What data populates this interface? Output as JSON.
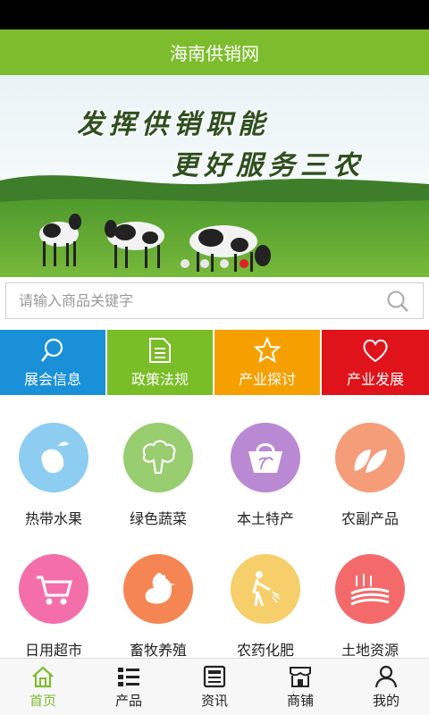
{
  "app": {
    "title": "海南供销网"
  },
  "banner": {
    "slogan_line1": "发挥供销职能",
    "slogan_line2": "更好服务三农",
    "slide_count": 4,
    "active_slide": 3
  },
  "search": {
    "placeholder": "请输入商品关键字"
  },
  "quick_links": [
    {
      "label": "展会信息",
      "icon": "search-icon",
      "color": "#1a90d8"
    },
    {
      "label": "政策法规",
      "icon": "document-icon",
      "color": "#79bd27"
    },
    {
      "label": "产业探讨",
      "icon": "star-icon",
      "color": "#f5a000"
    },
    {
      "label": "产业发展",
      "icon": "heart-icon",
      "color": "#e0131b"
    }
  ],
  "categories": [
    {
      "label": "热带水果",
      "icon": "mango-icon",
      "color": "#8ccdf1"
    },
    {
      "label": "绿色蔬菜",
      "icon": "broccoli-icon",
      "color": "#98cd70"
    },
    {
      "label": "本土特产",
      "icon": "basket-icon",
      "color": "#b98ad3"
    },
    {
      "label": "农副产品",
      "icon": "leaves-icon",
      "color": "#f59d78"
    },
    {
      "label": "日用超市",
      "icon": "cart-icon",
      "color": "#f46fa9"
    },
    {
      "label": "畜牧养殖",
      "icon": "chicken-icon",
      "color": "#f58552"
    },
    {
      "label": "农药化肥",
      "icon": "sprayer-icon",
      "color": "#f6ce6a"
    },
    {
      "label": "土地资源",
      "icon": "field-icon",
      "color": "#f46a6a"
    }
  ],
  "tabs": [
    {
      "label": "首页",
      "icon": "home-icon",
      "active": true
    },
    {
      "label": "产品",
      "icon": "list-icon",
      "active": false
    },
    {
      "label": "资讯",
      "icon": "news-icon",
      "active": false
    },
    {
      "label": "商铺",
      "icon": "shop-icon",
      "active": false
    },
    {
      "label": "我的",
      "icon": "user-icon",
      "active": false
    }
  ],
  "colors": {
    "brand_green": "#7dbd2d",
    "dot_active": "#e21f26"
  }
}
